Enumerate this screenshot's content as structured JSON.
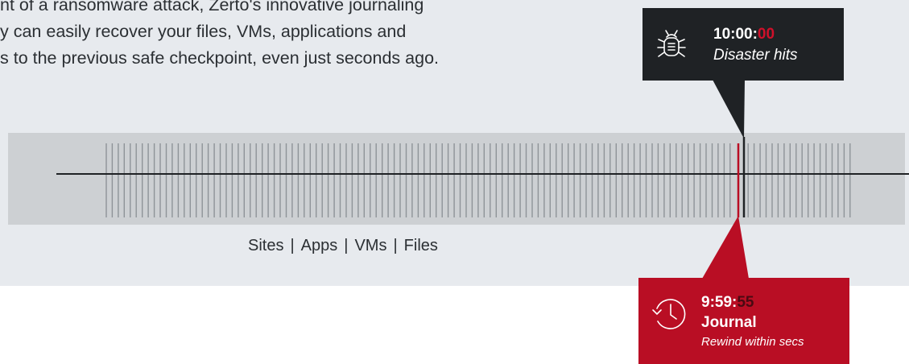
{
  "intro": {
    "lines": [
      "nt of a ransomware attack, Zerto's innovative journaling",
      "y can easily recover your files, VMs, applications and",
      "s to the previous safe checkpoint, even just seconds ago."
    ]
  },
  "caption": {
    "items": [
      "Sites",
      "Apps",
      "VMs",
      "Files"
    ],
    "separator": "|"
  },
  "disaster": {
    "time_prefix": "10:00:",
    "time_highlight": "00",
    "label": "Disaster hits",
    "icon": "bug-icon",
    "background": "#1f2225",
    "highlight_color": "#d0102a"
  },
  "journal": {
    "time_prefix": "9:59:",
    "time_highlight": "55",
    "title": "Journal",
    "subtitle": "Rewind within secs",
    "icon": "history-clock-icon",
    "background": "#b90e24"
  }
}
